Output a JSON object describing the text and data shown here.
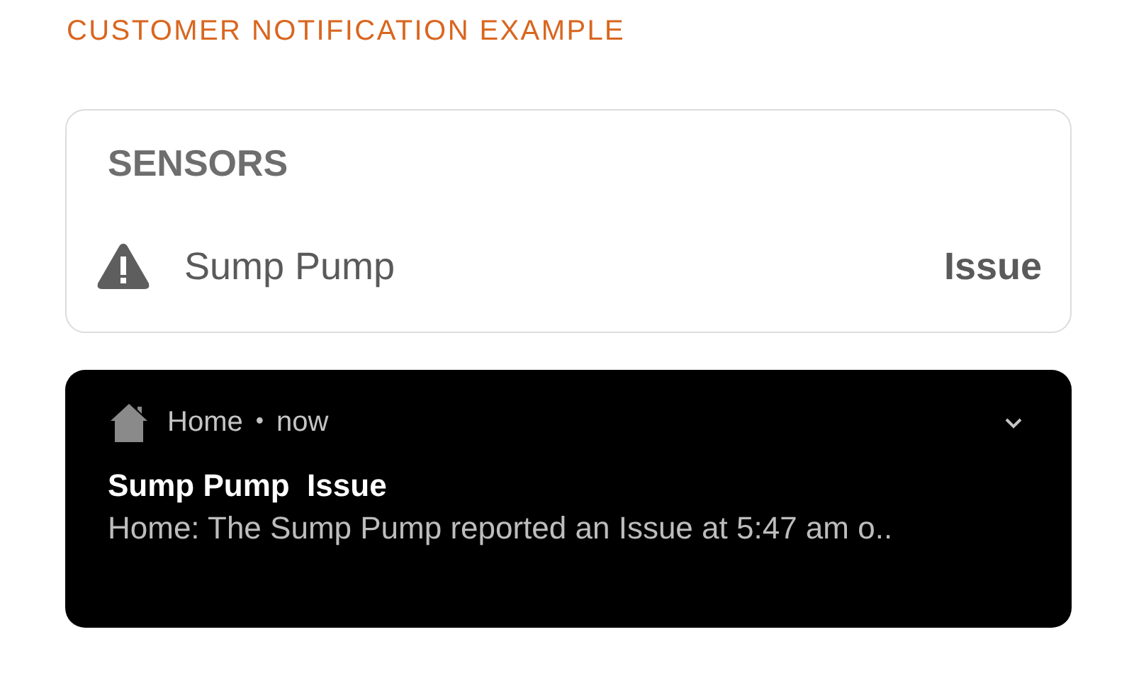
{
  "heading": "CUSTOMER NOTIFICATION EXAMPLE",
  "sensors": {
    "title": "SENSORS",
    "items": [
      {
        "name": "Sump Pump",
        "status": "Issue"
      }
    ]
  },
  "notification": {
    "app": "Home",
    "separator": "•",
    "time": "now",
    "title": "Sump Pump  Issue",
    "body": "Home: The Sump Pump reported an Issue at 5:47 am o.."
  }
}
